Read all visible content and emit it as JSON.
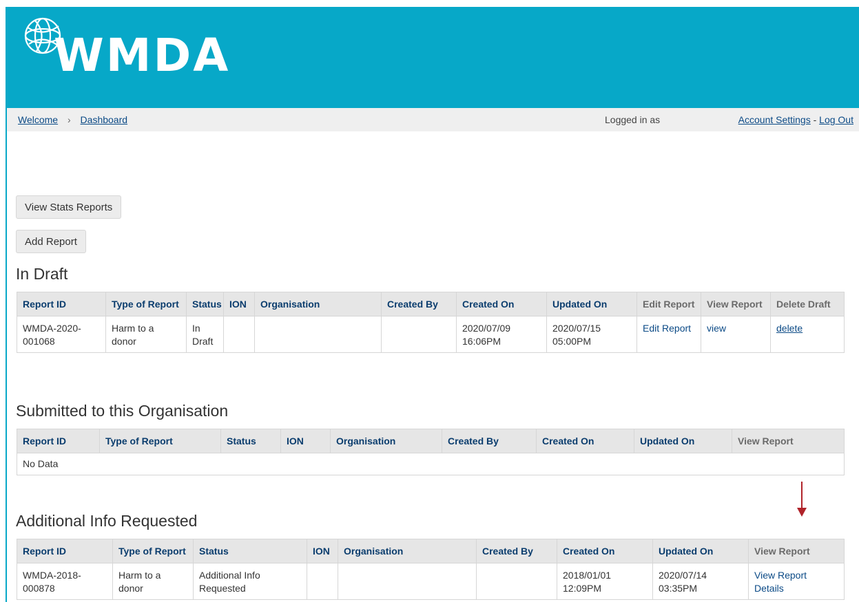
{
  "header": {
    "logo_text": "WMDA"
  },
  "topbar": {
    "breadcrumbs": [
      "Welcome",
      "Dashboard"
    ],
    "logged_in_as": "Logged in as",
    "account_settings": "Account Settings",
    "separator": "-",
    "log_out": "Log Out"
  },
  "buttons": {
    "view_stats": "View Stats Reports",
    "add_report": "Add Report"
  },
  "draft": {
    "title": "In Draft",
    "headers": [
      "Report ID",
      "Type of Report",
      "Status",
      "ION",
      "Organisation",
      "Created By",
      "Created On",
      "Updated On",
      "Edit Report",
      "View Report",
      "Delete Draft"
    ],
    "rows": [
      {
        "report_id": "WMDA-2020-001068",
        "type": "Harm to a donor",
        "status": "In Draft",
        "ion": "",
        "organisation": "",
        "created_by": "",
        "created_on": "2020/07/09 16:06PM",
        "updated_on": "2020/07/15 05:00PM",
        "edit": "Edit Report",
        "view": "view",
        "delete": "delete"
      }
    ]
  },
  "submitted": {
    "title": "Submitted to this Organisation",
    "headers": [
      "Report ID",
      "Type of Report",
      "Status",
      "ION",
      "Organisation",
      "Created By",
      "Created On",
      "Updated On",
      "View Report"
    ],
    "empty_text": "No Data"
  },
  "additional": {
    "title": "Additional Info Requested",
    "headers": [
      "Report ID",
      "Type of Report",
      "Status",
      "ION",
      "Organisation",
      "Created By",
      "Created On",
      "Updated On",
      "View Report"
    ],
    "rows": [
      {
        "report_id": "WMDA-2018-000878",
        "type": "Harm to a donor",
        "status": "Additional Info Requested",
        "ion": "",
        "organisation": "",
        "created_by": "",
        "created_on": "2018/01/01 12:09PM",
        "updated_on": "2020/07/14 03:35PM",
        "view": "View Report Details"
      }
    ]
  },
  "colors": {
    "header_bg": "#07a8c8",
    "link": "#0b4a86",
    "header_text": "#0b3d6e",
    "arrow": "#b0232a"
  }
}
